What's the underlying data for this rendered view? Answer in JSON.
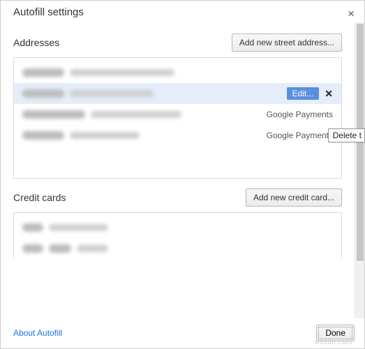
{
  "dialog": {
    "title": "Autofill settings",
    "close_icon": "×"
  },
  "addresses": {
    "title": "Addresses",
    "add_button": "Add new street address...",
    "rows": [
      {
        "source": ""
      },
      {
        "source": "",
        "edit_label": "Edit...",
        "delete_icon": "✕"
      },
      {
        "source": "Google Payments"
      },
      {
        "source": "Google Payments"
      }
    ]
  },
  "tooltip": {
    "text": "Delete t"
  },
  "cards": {
    "title": "Credit cards",
    "add_button": "Add new credit card..."
  },
  "footer": {
    "about_link": "About Autofill",
    "done_label": "Done"
  },
  "watermark": "wsxdn.com"
}
